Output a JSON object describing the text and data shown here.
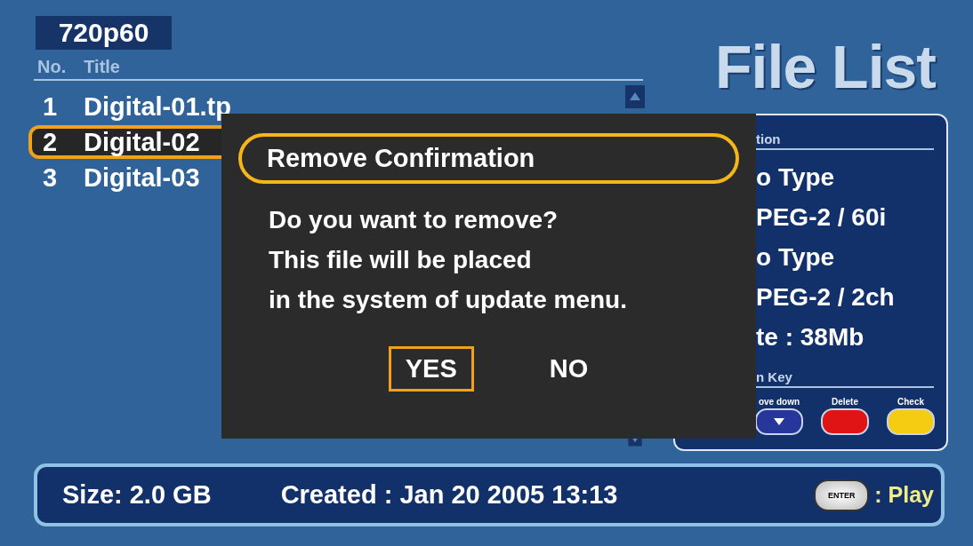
{
  "resolution": "720p60",
  "title": "File List",
  "file_list": {
    "columns": [
      "No.",
      "Title"
    ],
    "rows": [
      {
        "no": "1",
        "title": "Digital-01.tp",
        "selected": false
      },
      {
        "no": "2",
        "title": "Digital-02",
        "selected": true
      },
      {
        "no": "3",
        "title": "Digital-03",
        "selected": false
      }
    ]
  },
  "info_panel": {
    "heading": "tion",
    "lines": [
      "o Type",
      "PEG-2 / 60i",
      "o Type",
      "PEG-2 / 2ch",
      "te : 38Mb"
    ],
    "key_heading": "n Key",
    "keys": [
      {
        "label": "ove down",
        "color": "#26369a",
        "kind": "arrow"
      },
      {
        "label": "Delete",
        "color": "#e01414",
        "kind": "plain"
      },
      {
        "label": "Check",
        "color": "#f5cc12",
        "kind": "plain"
      }
    ]
  },
  "status_bar": {
    "size": "Size: 2.0 GB",
    "created": "Created : Jan 20 2005 13:13",
    "enter_key": "ENTER",
    "action": ": Play"
  },
  "dialog": {
    "title": "Remove Confirmation",
    "message": [
      "Do you want to remove?",
      "This file will be placed",
      "in the system of update menu."
    ],
    "buttons": [
      {
        "label": "YES",
        "selected": true
      },
      {
        "label": "NO",
        "selected": false
      }
    ]
  }
}
